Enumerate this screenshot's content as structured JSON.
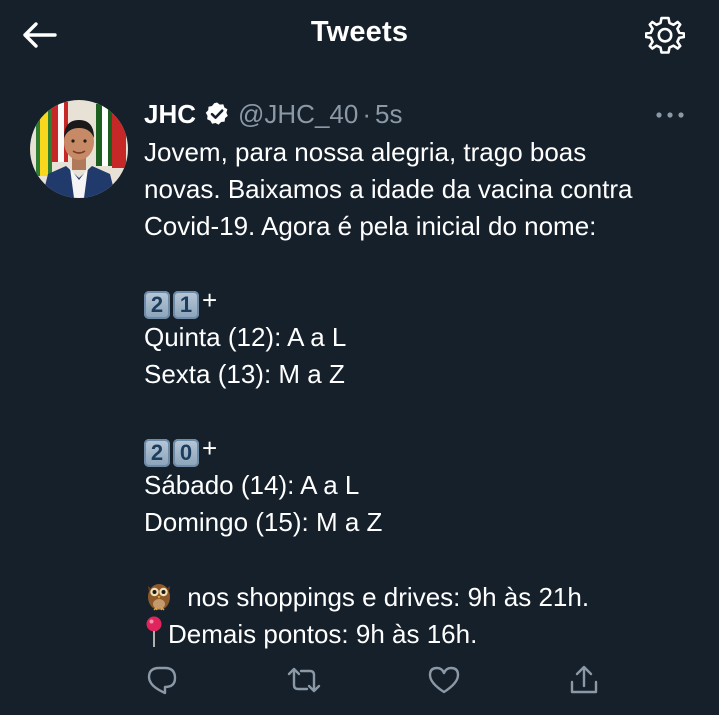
{
  "header": {
    "title": "Tweets",
    "back_icon": "arrow-left-icon",
    "settings_icon": "gear-icon"
  },
  "tweet": {
    "display_name": "JHC",
    "handle": "@JHC_40",
    "separator": "·",
    "time": "5s",
    "verified": true,
    "intro_lines": [
      "Jovem, para nossa alegria, trago boas",
      "novas. Baixamos a idade da vacina contra",
      "Covid-19. Agora é pela inicial do nome:"
    ],
    "group1": {
      "keycaps": [
        "2",
        "1"
      ],
      "suffix": "+",
      "lines": [
        "Quinta (12): A a L",
        "Sexta (13): M a Z"
      ]
    },
    "group2": {
      "keycaps": [
        "2",
        "0"
      ],
      "suffix": "+",
      "lines": [
        "Sábado (14): A a L",
        "Domingo (15): M a Z"
      ]
    },
    "info_lines": [
      {
        "icon": "owl-icon",
        "text": " nos shoppings e drives: 9h às 21h."
      },
      {
        "icon": "pin-icon",
        "text": "Demais pontos: 9h às 16h."
      }
    ]
  },
  "actions": [
    {
      "name": "reply-icon"
    },
    {
      "name": "retweet-icon"
    },
    {
      "name": "like-icon"
    },
    {
      "name": "share-icon"
    }
  ],
  "colors": {
    "background": "#15202b",
    "text": "#ffffff",
    "secondary": "#8b98a5",
    "verified": "#ffffff"
  }
}
